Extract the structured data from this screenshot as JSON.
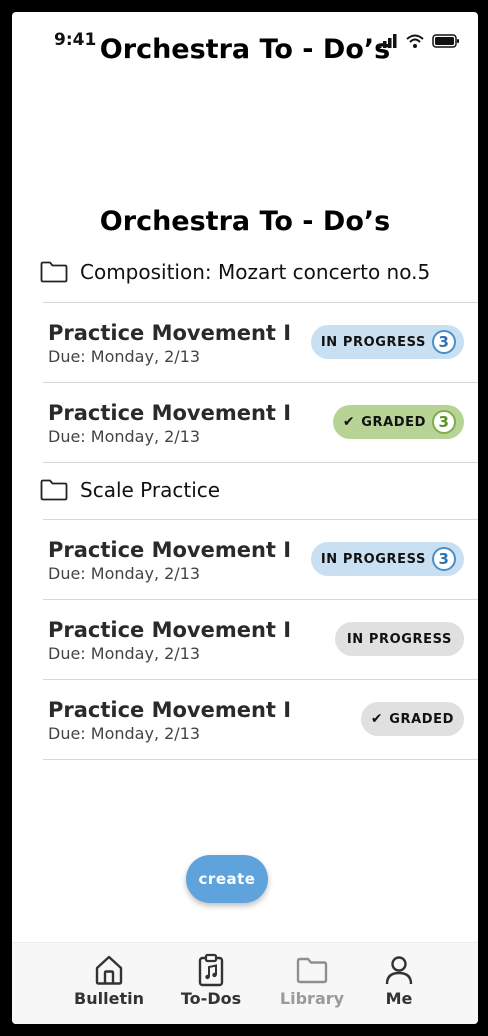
{
  "status_bar": {
    "time": "9:41"
  },
  "header": {
    "title": "Orchestra To - Do’s"
  },
  "page": {
    "title": "Orchestra To - Do’s"
  },
  "groups": [
    {
      "folder": "Composition: Mozart concerto no.5",
      "tasks": [
        {
          "title": "Practice Movement I",
          "due": "Due: Monday, 2/13",
          "status": "IN PROGRESS",
          "count": "3",
          "color": "#c9dff2"
        },
        {
          "title": "Practice Movement I",
          "due": "Due: Monday, 2/13",
          "status": "GRADED",
          "count": "3",
          "color": "#b7d395"
        }
      ]
    },
    {
      "folder": "Scale Practice",
      "tasks": [
        {
          "title": "Practice Movement I",
          "due": "Due: Monday, 2/13",
          "status": "IN PROGRESS",
          "count": "3",
          "color": "#c9dff2"
        },
        {
          "title": "Practice Movement I",
          "due": "Due: Monday, 2/13",
          "status": "IN PROGRESS",
          "count": "",
          "color": "#e0e0e0"
        },
        {
          "title": "Practice Movement I",
          "due": "Due: Monday, 2/13",
          "status": "GRADED",
          "count": "",
          "color": "#e0e0e0"
        }
      ]
    }
  ],
  "create_button": {
    "label": "create",
    "color": "#5fa3dc"
  },
  "tab_bar": {
    "items": [
      {
        "label": "Bulletin",
        "icon": "home-icon",
        "active": true
      },
      {
        "label": "To-Dos",
        "icon": "clipboard-music-icon",
        "active": true
      },
      {
        "label": "Library",
        "icon": "folder-icon",
        "active": false
      },
      {
        "label": "Me",
        "icon": "person-icon",
        "active": true
      }
    ]
  }
}
